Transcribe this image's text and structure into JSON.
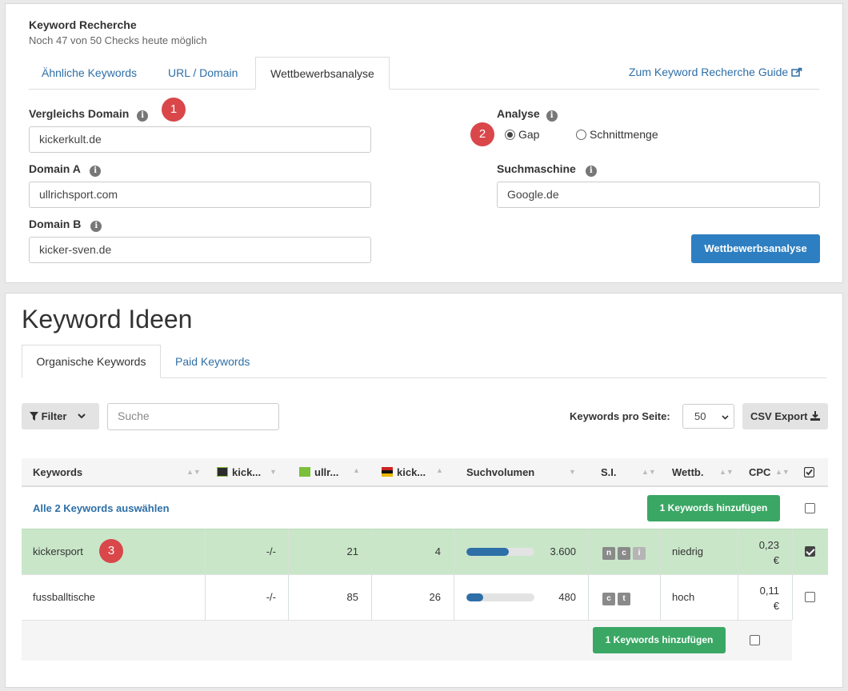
{
  "header": {
    "title": "Keyword Recherche",
    "subtitle": "Noch 47 von 50 Checks heute möglich"
  },
  "tabs": [
    {
      "label": "Ähnliche Keywords"
    },
    {
      "label": "URL / Domain"
    },
    {
      "label": "Wettbewerbsanalyse"
    }
  ],
  "guide_link": "Zum Keyword Recherche Guide",
  "form": {
    "compare_domain": {
      "label": "Vergleichs Domain",
      "value": "kickerkult.de"
    },
    "domain_a": {
      "label": "Domain A",
      "value": "ullrichsport.com"
    },
    "domain_b": {
      "label": "Domain B",
      "value": "kicker-sven.de"
    },
    "analysis": {
      "label": "Analyse",
      "options": [
        "Gap",
        "Schnittmenge"
      ],
      "selected": "Gap"
    },
    "search_engine": {
      "label": "Suchmaschine",
      "value": "Google.de"
    },
    "submit": "Wettbewerbsanalyse"
  },
  "markers": [
    "1",
    "2",
    "3"
  ],
  "ideas": {
    "title": "Keyword Ideen",
    "tabs": [
      "Organische Keywords",
      "Paid Keywords"
    ],
    "filter_label": "Filter",
    "search_placeholder": "Suche",
    "per_page_label": "Keywords pro Seite:",
    "per_page_value": "50",
    "csv_label": "CSV Export"
  },
  "table": {
    "columns": [
      "Keywords",
      "kick...",
      "ullr...",
      "kick...",
      "Suchvolumen",
      "S.I.",
      "Wettb.",
      "CPC"
    ],
    "select_all": "Alle 2 Keywords auswählen",
    "add_button": "1 Keywords hinzufügen",
    "rows": [
      {
        "keyword": "kickersport",
        "a": "-/-",
        "b": "21",
        "c": "4",
        "volume": "3.600",
        "volume_fill": 0.62,
        "si": [
          "n",
          "c",
          "i"
        ],
        "competition": "niedrig",
        "cpc": [
          "0,23",
          "€"
        ],
        "checked": true
      },
      {
        "keyword": "fussballtische",
        "a": "-/-",
        "b": "85",
        "c": "26",
        "volume": "480",
        "volume_fill": 0.25,
        "si": [
          "c",
          "t"
        ],
        "competition": "hoch",
        "cpc": [
          "0,11",
          "€"
        ],
        "checked": false
      }
    ]
  },
  "colors": {
    "accent": "#2e6fa7",
    "green": "#3aa764",
    "row_highlight": "#c9e6c9",
    "marker": "#d9474a"
  }
}
